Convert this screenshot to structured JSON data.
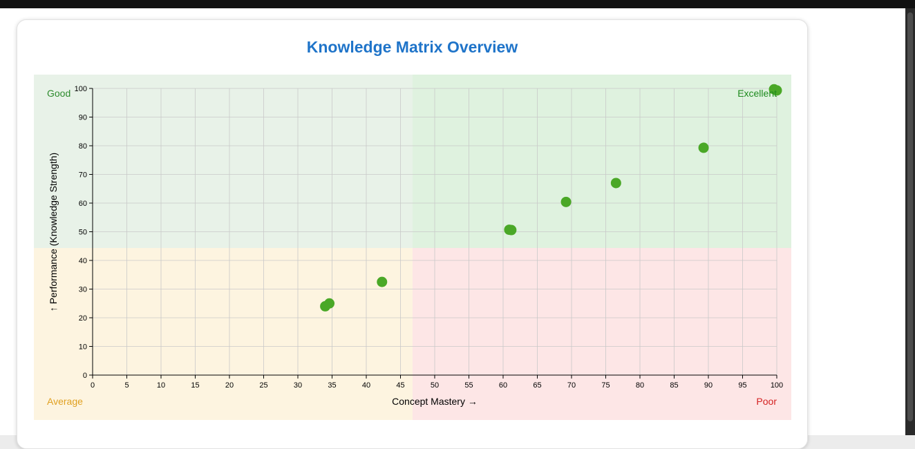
{
  "page": {
    "title": "Knowledge Matrix Overview"
  },
  "quadrants": {
    "good": {
      "label": "Good",
      "color": "#e8f2e8",
      "text_color": "#2c8a2c"
    },
    "excellent": {
      "label": "Excellent",
      "color": "#dff2df",
      "text_color": "#1e8a1e"
    },
    "average": {
      "label": "Average",
      "color": "#fdf4e0",
      "text_color": "#e0a020"
    },
    "poor": {
      "label": "Poor",
      "color": "#fde6e6",
      "text_color": "#d42020"
    }
  },
  "colors": {
    "point": "#4aa827",
    "title": "#1f74c9",
    "grid": "#c8c8c8"
  },
  "chart_data": {
    "type": "scatter",
    "title": "Knowledge Matrix Overview",
    "xlabel": "Concept Mastery →",
    "ylabel": "↑ Performance (Knowledge Strength)",
    "xlim": [
      0,
      100
    ],
    "ylim": [
      0,
      100
    ],
    "x_ticks": [
      0,
      5,
      10,
      15,
      20,
      25,
      30,
      35,
      40,
      45,
      50,
      55,
      60,
      65,
      70,
      75,
      80,
      85,
      90,
      95,
      100
    ],
    "y_ticks": [
      0,
      10,
      20,
      30,
      40,
      50,
      60,
      70,
      80,
      90,
      100
    ],
    "grid": true,
    "quadrant_split": {
      "x": 47,
      "y": 44
    },
    "points": [
      {
        "x": 34.0,
        "y": 24.0
      },
      {
        "x": 34.6,
        "y": 25.0
      },
      {
        "x": 42.3,
        "y": 32.5
      },
      {
        "x": 60.9,
        "y": 50.7
      },
      {
        "x": 61.2,
        "y": 50.6
      },
      {
        "x": 69.2,
        "y": 60.4
      },
      {
        "x": 76.5,
        "y": 67.0
      },
      {
        "x": 89.3,
        "y": 79.3
      },
      {
        "x": 99.6,
        "y": 99.7
      },
      {
        "x": 100,
        "y": 99.3
      }
    ]
  }
}
